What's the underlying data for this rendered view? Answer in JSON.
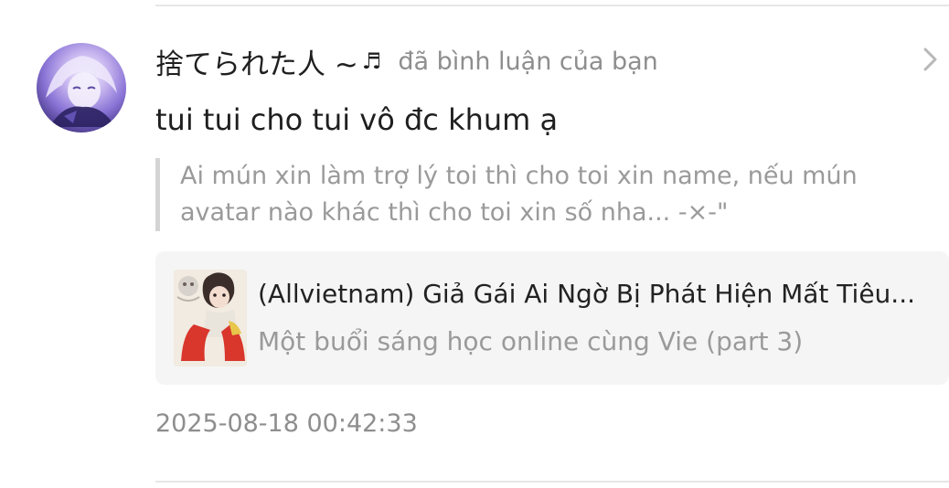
{
  "notification": {
    "username": "捨てられた人 ~",
    "username_suffix_icon": "music-note-icon",
    "username_suffix_glyph": "♬",
    "action_text": "đã bình luận của bạn",
    "comment_text": "tui tui cho tui vô đc khum ạ",
    "quoted_comment": {
      "line1": "Ai mún xin làm trợ lý toi thì cho toi xin name, nếu mún",
      "line2": "avatar nào khác thì cho toi xin số nha... -×-\""
    },
    "story_card": {
      "title": "(Allvietnam) Giả Gái Ai Ngờ Bị Phát Hiện Mất Tiêu...",
      "chapter": "Một buổi sáng học online cùng Vie (part 3)",
      "cover_icon": "story-cover-image"
    },
    "timestamp": "2025-08-18 00:42:33",
    "chevron_icon": "chevron-right-icon"
  },
  "colors": {
    "text_primary": "#1f1f1f",
    "text_secondary": "#8e8e8e",
    "quote_text": "#9a9a9a",
    "quote_bar": "#d4d4d4",
    "card_background": "#f5f5f5",
    "divider": "#e6e6e6"
  }
}
